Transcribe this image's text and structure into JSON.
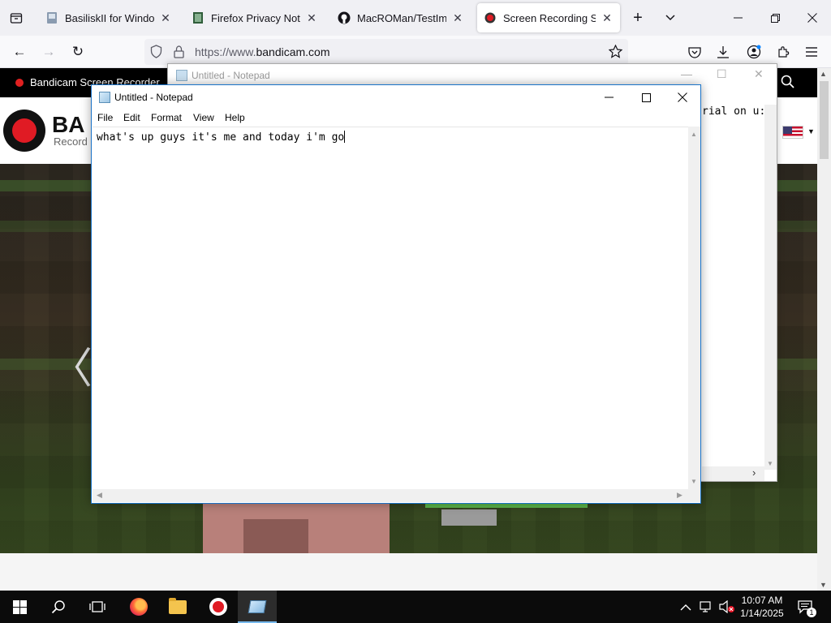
{
  "browser": {
    "tabs": [
      {
        "title": "BasiliskII for Windows -",
        "favicon": "app-file-icon",
        "active": false
      },
      {
        "title": "Firefox Privacy Notice —",
        "favicon": "firefox-doc-icon",
        "active": false
      },
      {
        "title": "MacROMan/TestImage",
        "favicon": "github-icon",
        "active": false
      },
      {
        "title": "Screen Recording Softw",
        "favicon": "bandicam-icon",
        "active": true
      }
    ],
    "url": {
      "prefix": "https://www.",
      "domain": "bandicam.com"
    }
  },
  "website": {
    "header_title": "Bandicam Screen Recorder",
    "logo_text": "BA",
    "logo_subtext": "Record"
  },
  "notepad_back": {
    "title": "Untitled - Notepad",
    "visible_text": "rial on u:"
  },
  "notepad": {
    "title": "Untitled - Notepad",
    "menu": [
      "File",
      "Edit",
      "Format",
      "View",
      "Help"
    ],
    "content": "what's up guys it's me and today i'm go"
  },
  "taskbar": {
    "time": "10:07 AM",
    "date": "1/14/2025",
    "notification_count": "1"
  },
  "colors": {
    "accent": "#1a73c8",
    "bandicam_red": "#e01b24",
    "taskbar": "#0b0b0b"
  }
}
